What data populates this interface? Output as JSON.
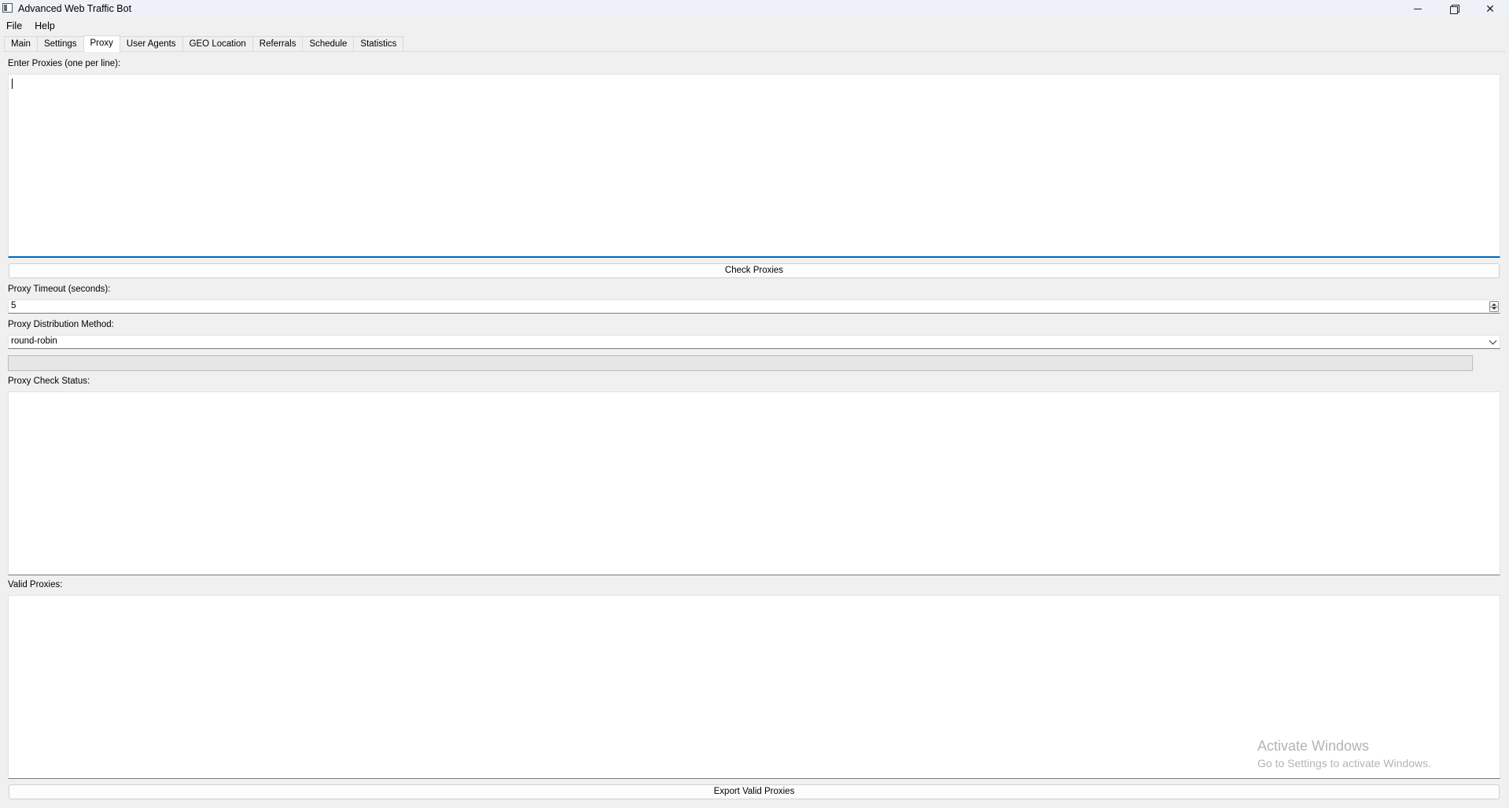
{
  "window": {
    "title": "Advanced Web Traffic Bot",
    "minimize_label": "",
    "maximize_label": "",
    "close_label": "✕"
  },
  "menu": [
    "File",
    "Help"
  ],
  "tabs": [
    {
      "label": "Main"
    },
    {
      "label": "Settings"
    },
    {
      "label": "Proxy"
    },
    {
      "label": "User Agents"
    },
    {
      "label": "GEO Location"
    },
    {
      "label": "Referrals"
    },
    {
      "label": "Schedule"
    },
    {
      "label": "Statistics"
    }
  ],
  "active_tab": "Proxy",
  "proxy": {
    "enter_label": "Enter Proxies (one per line):",
    "enter_value": "",
    "check_button": "Check Proxies",
    "timeout_label": "Proxy Timeout (seconds):",
    "timeout_value": "5",
    "distribution_label": "Proxy Distribution Method:",
    "distribution_value": "round-robin",
    "progress": 0,
    "status_label": "Proxy Check Status:",
    "status_value": "",
    "valid_label": "Valid Proxies:",
    "valid_value": "",
    "export_button": "Export Valid Proxies"
  },
  "watermark": {
    "title": "Activate Windows",
    "subtitle": "Go to Settings to activate Windows."
  }
}
